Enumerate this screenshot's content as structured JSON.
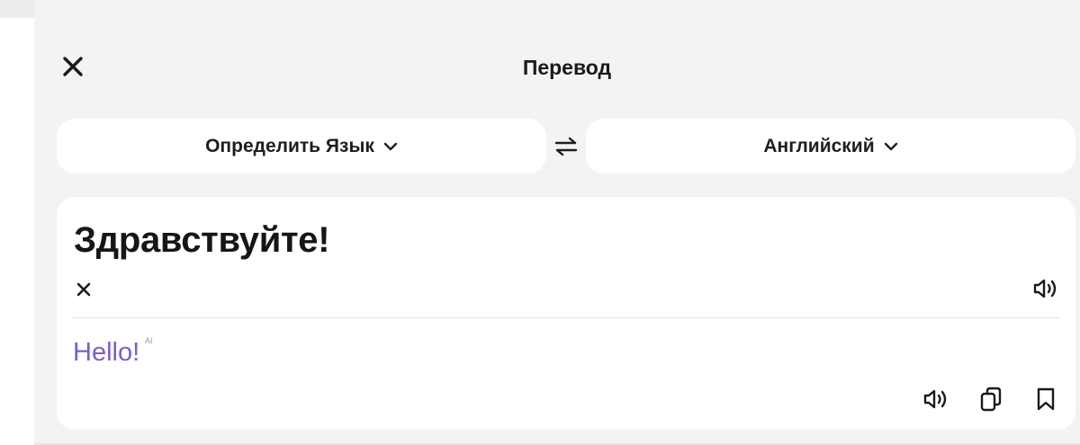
{
  "header": {
    "title": "Перевод"
  },
  "languages": {
    "source_label": "Определить Язык",
    "target_label": "Английский"
  },
  "translation": {
    "source_text": "Здравствуйте!",
    "result_text": "Hello!",
    "ai_badge": "AI"
  },
  "icons": {
    "close": "close-icon",
    "swap": "swap-arrows-icon",
    "chevron": "chevron-down-icon",
    "clear": "clear-icon",
    "speaker": "speaker-icon",
    "copy": "copy-icon",
    "bookmark": "bookmark-icon"
  },
  "colors": {
    "result_text": "#7b5cd0",
    "background": "#f3f3f3",
    "card": "#ffffff"
  }
}
